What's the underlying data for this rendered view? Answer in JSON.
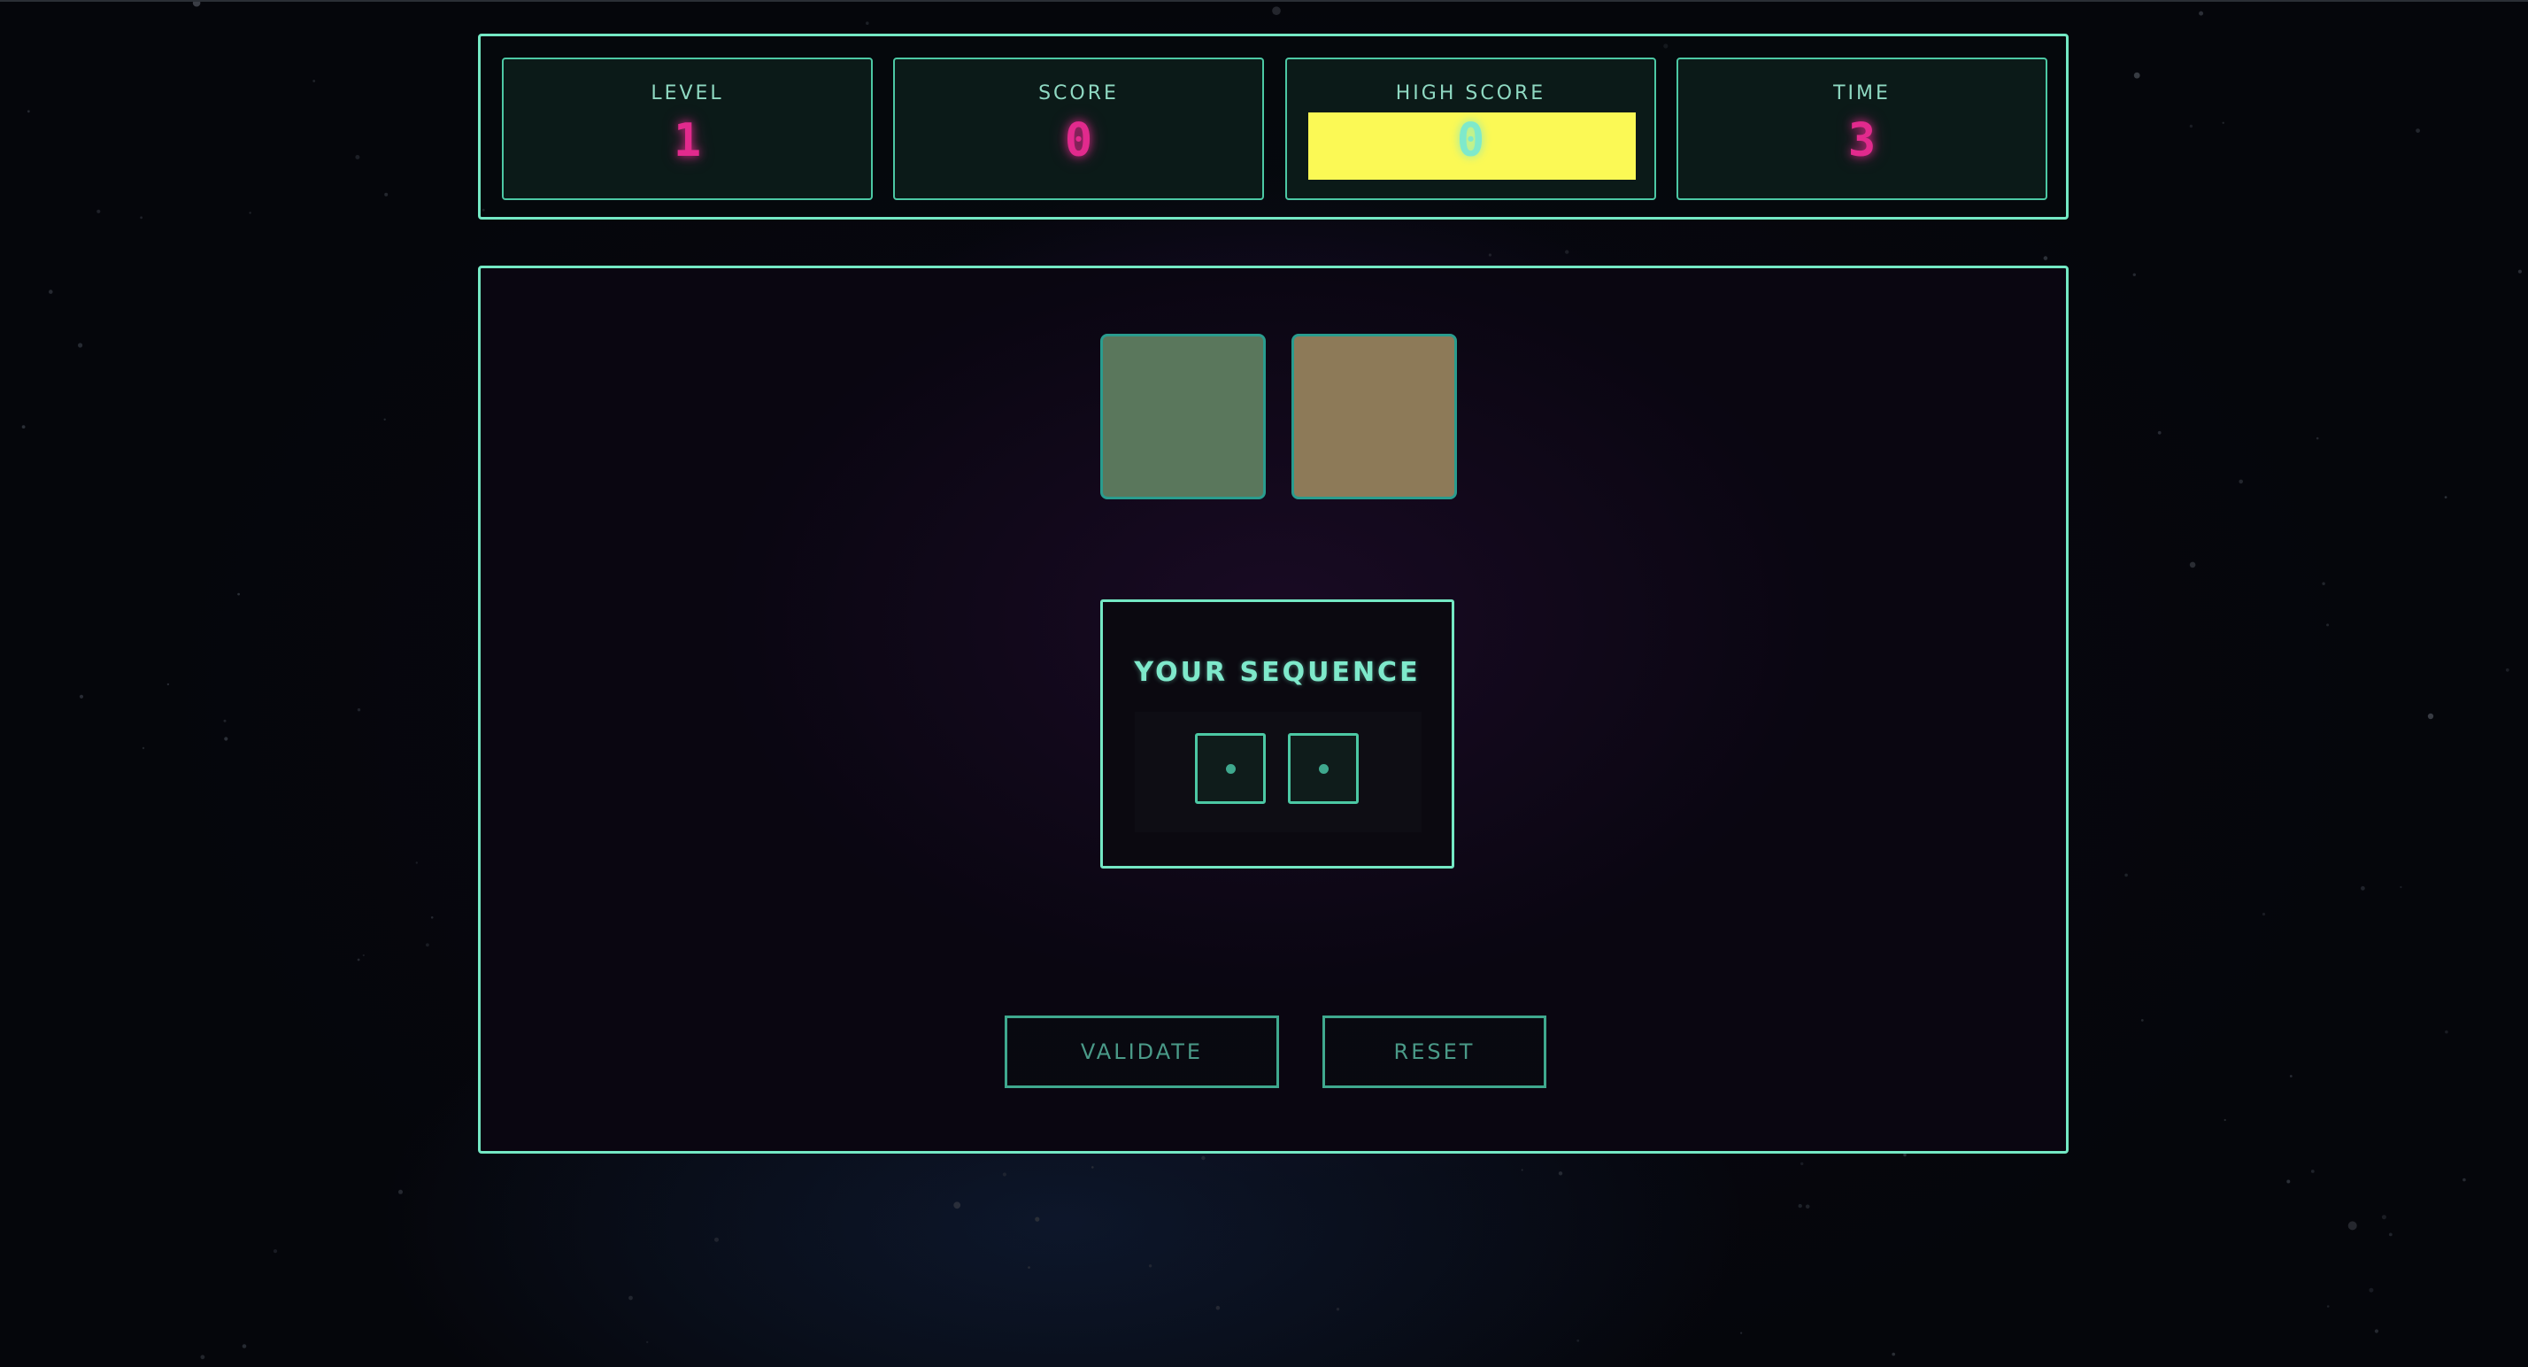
{
  "hud": {
    "level": {
      "label": "LEVEL",
      "value": "1"
    },
    "score": {
      "label": "SCORE",
      "value": "0"
    },
    "high_score": {
      "label": "HIGH SCORE",
      "value": "0",
      "highlight_color": "#fbf955"
    },
    "time": {
      "label": "TIME",
      "value": "3"
    }
  },
  "board": {
    "tiles": [
      {
        "color": "#5a775c"
      },
      {
        "color": "#8d7a58"
      }
    ],
    "sequence": {
      "title": "YOUR SEQUENCE",
      "slots": [
        "•",
        "•"
      ]
    },
    "buttons": {
      "validate_label": "VALIDATE",
      "reset_label": "RESET"
    }
  },
  "colors": {
    "accent": "#74e8c4",
    "value_pink": "#e22a8d",
    "background": "#05060b"
  }
}
